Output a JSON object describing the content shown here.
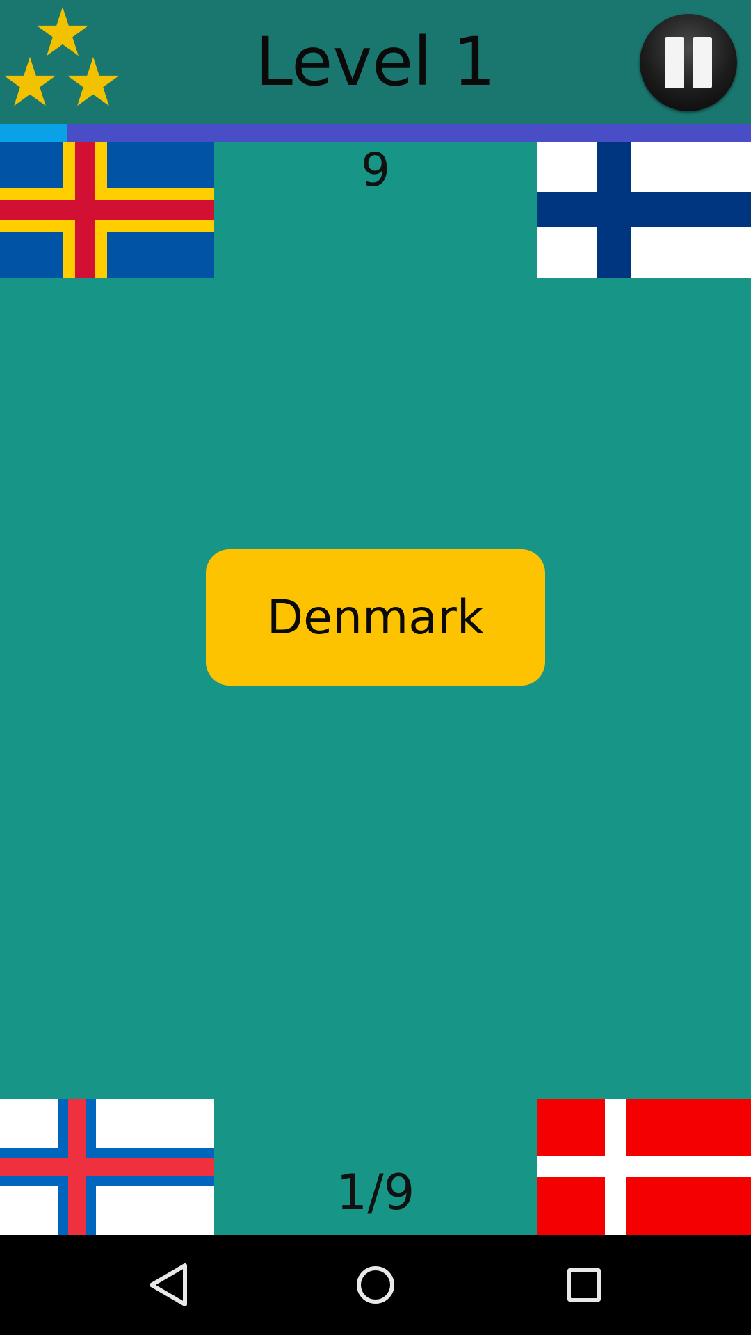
{
  "header": {
    "title": "Level 1",
    "stars_earned": 3,
    "star_color": "#f2c200"
  },
  "progress": {
    "fraction": 0.09,
    "fill_color": "#0aa2e6",
    "track_color": "#4a4ec6"
  },
  "timer": "9",
  "answer": {
    "label": "Denmark",
    "color": "#fdc300"
  },
  "counter": "1/9",
  "flags": [
    {
      "position": "top-left",
      "country": "aland-flag"
    },
    {
      "position": "top-right",
      "country": "finland-flag"
    },
    {
      "position": "bottom-left",
      "country": "faroe-islands-flag"
    },
    {
      "position": "bottom-right",
      "country": "denmark-flag"
    }
  ],
  "navbar": {
    "icons": [
      "back-icon",
      "home-icon",
      "recents-icon"
    ]
  },
  "colors": {
    "background": "#179586",
    "header": "#1a776f"
  }
}
